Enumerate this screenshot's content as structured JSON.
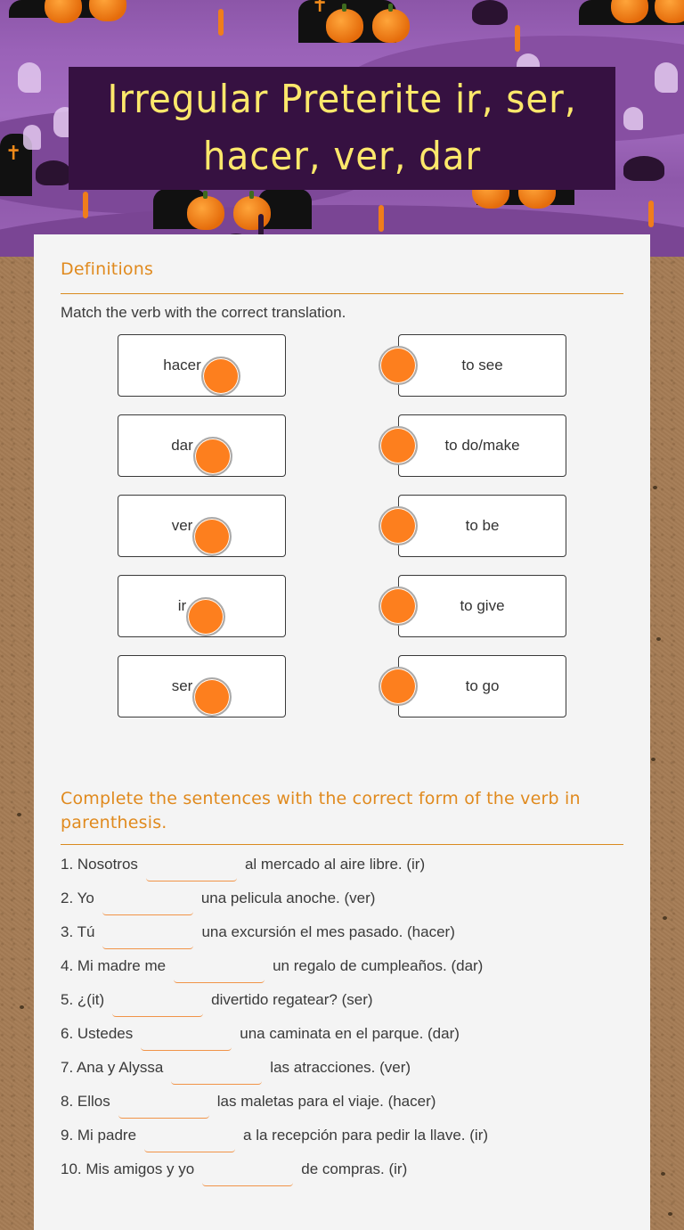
{
  "title": "Irregular Preterite ir, ser, hacer, ver, dar",
  "colors": {
    "banner_bg": "#361141",
    "title_text": "#fde86b",
    "accent_orange": "#fd7f1e",
    "section_heading": "#e08a1e",
    "blank_underline": "#f19448"
  },
  "definitions": {
    "heading": "Definitions",
    "instruction": "Match the verb with the correct translation.",
    "left_items": [
      "hacer",
      "dar",
      "ver",
      "ir",
      "ser"
    ],
    "right_items": [
      "to see",
      "to do/make",
      "to be",
      "to give",
      "to go"
    ]
  },
  "sentences_section": {
    "heading": "Complete the sentences with the correct form of the verb in parenthesis.",
    "items": [
      {
        "before": "1. Nosotros",
        "answer": "",
        "after": "al mercado al aire libre. (ir)"
      },
      {
        "before": "2. Yo",
        "answer": "",
        "after": "una pelicula anoche. (ver)"
      },
      {
        "before": "3. Tú",
        "answer": "",
        "after": "una excursión el mes pasado. (hacer)"
      },
      {
        "before": "4. Mi madre me",
        "answer": "",
        "after": "un regalo de cumpleaños. (dar)"
      },
      {
        "before": "5. ¿(it)",
        "answer": "",
        "after": "divertido regatear? (ser)"
      },
      {
        "before": "6. Ustedes",
        "answer": "",
        "after": "una caminata en el parque. (dar)"
      },
      {
        "before": "7. Ana y Alyssa",
        "answer": "",
        "after": "las atracciones. (ver)"
      },
      {
        "before": "8. Ellos",
        "answer": "",
        "after": "las maletas para el viaje. (hacer)"
      },
      {
        "before": "9. Mi padre",
        "answer": "",
        "after": "a la recepción para pedir la llave. (ir)"
      },
      {
        "before": "10. Mis amigos y yo",
        "answer": "",
        "after": "de compras. (ir)"
      }
    ]
  }
}
